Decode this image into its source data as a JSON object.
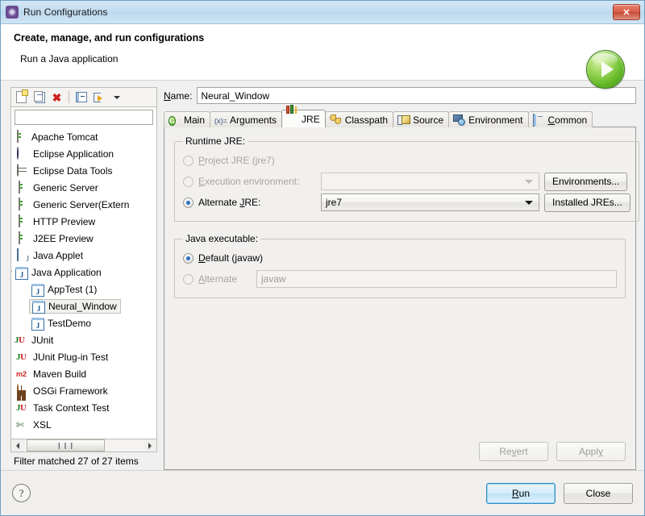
{
  "window": {
    "title": "Run Configurations",
    "title_icon": "gear-icon",
    "close_label": "✕"
  },
  "header": {
    "title": "Create, manage, and run configurations",
    "subtitle": "Run a Java application",
    "badge_icon": "run-play-icon"
  },
  "toolbar": {
    "new_icon": "new-configuration-icon",
    "duplicate_icon": "duplicate-configuration-icon",
    "delete_icon": "delete-configuration-icon",
    "collapse_icon": "collapse-all-icon",
    "filter_icon": "filter-configurations-icon",
    "menu_icon": "chevron-down-icon"
  },
  "filter": {
    "value": "",
    "placeholder": "",
    "status": "Filter matched 27 of 27 items"
  },
  "tree": {
    "items": [
      {
        "label": "Apache Tomcat",
        "icon": "server-icon",
        "indent": 0,
        "twisty": "closed",
        "selected": false
      },
      {
        "label": "Eclipse Application",
        "icon": "eclipse-icon",
        "indent": 0,
        "twisty": "none",
        "selected": false
      },
      {
        "label": "Eclipse Data Tools",
        "icon": "database-icon",
        "indent": 0,
        "twisty": "none",
        "selected": false
      },
      {
        "label": "Generic Server",
        "icon": "server-icon",
        "indent": 0,
        "twisty": "none",
        "selected": false
      },
      {
        "label": "Generic Server(Extern",
        "icon": "server-icon",
        "indent": 0,
        "twisty": "none",
        "selected": false
      },
      {
        "label": "HTTP Preview",
        "icon": "server-icon",
        "indent": 0,
        "twisty": "none",
        "selected": false
      },
      {
        "label": "J2EE Preview",
        "icon": "server-icon",
        "indent": 0,
        "twisty": "none",
        "selected": false
      },
      {
        "label": "Java Applet",
        "icon": "java-applet-icon",
        "indent": 0,
        "twisty": "none",
        "selected": false
      },
      {
        "label": "Java Application",
        "icon": "java-app-icon",
        "indent": 0,
        "twisty": "open",
        "selected": false
      },
      {
        "label": "AppTest (1)",
        "icon": "java-app-icon",
        "indent": 1,
        "twisty": "none",
        "selected": false
      },
      {
        "label": "Neural_Window",
        "icon": "java-app-icon",
        "indent": 1,
        "twisty": "none",
        "selected": true
      },
      {
        "label": "TestDemo",
        "icon": "java-app-icon",
        "indent": 1,
        "twisty": "none",
        "selected": false
      },
      {
        "label": "JUnit",
        "icon": "junit-icon",
        "indent": 0,
        "twisty": "closed",
        "selected": false
      },
      {
        "label": "JUnit Plug-in Test",
        "icon": "junit-plugin-icon",
        "indent": 0,
        "twisty": "none",
        "selected": false
      },
      {
        "label": "Maven Build",
        "icon": "maven-icon",
        "indent": 0,
        "twisty": "none",
        "selected": false
      },
      {
        "label": "OSGi Framework",
        "icon": "osgi-icon",
        "indent": 0,
        "twisty": "none",
        "selected": false
      },
      {
        "label": "Task Context Test",
        "icon": "junit-icon",
        "indent": 0,
        "twisty": "none",
        "selected": false
      },
      {
        "label": "XSL",
        "icon": "xsl-icon",
        "indent": 0,
        "twisty": "none",
        "selected": false
      }
    ]
  },
  "name_field": {
    "label": "Name:",
    "value": "Neural_Window"
  },
  "tabs": [
    {
      "label": "Main",
      "icon": "main-icon",
      "active": false
    },
    {
      "label": "Arguments",
      "icon": "arguments-icon",
      "active": false
    },
    {
      "label": "JRE",
      "icon": "jre-icon",
      "active": true
    },
    {
      "label": "Classpath",
      "icon": "classpath-icon",
      "active": false
    },
    {
      "label": "Source",
      "icon": "source-icon",
      "active": false
    },
    {
      "label": "Environment",
      "icon": "environment-icon",
      "active": false
    },
    {
      "label": "Common",
      "icon": "common-icon",
      "active": false
    }
  ],
  "jre_tab": {
    "runtime_group": {
      "legend": "Runtime JRE:",
      "project_jre_label": "Project JRE (jre7)",
      "project_jre_checked": false,
      "project_jre_disabled": true,
      "exec_env_label": "Execution environment:",
      "exec_env_checked": false,
      "exec_env_disabled": true,
      "exec_env_value": "",
      "environments_button": "Environments...",
      "alternate_jre_label": "Alternate JRE:",
      "alternate_jre_checked": true,
      "alternate_jre_value": "jre7",
      "installed_jres_button": "Installed JREs..."
    },
    "executable_group": {
      "legend": "Java executable:",
      "default_label": "Default (javaw)",
      "default_checked": true,
      "alternate_label": "Alternate",
      "alternate_checked": false,
      "alternate_value": "",
      "alternate_placeholder": "javaw"
    }
  },
  "actions": {
    "revert": "Revert",
    "revert_disabled": true,
    "apply": "Apply",
    "apply_disabled": true
  },
  "footer": {
    "help_icon": "help-icon",
    "help_glyph": "?",
    "run": "Run",
    "close": "Close"
  },
  "colors": {
    "titlebar": "#c4ddf0",
    "accent_default_button": "#2a8ac4",
    "close_button": "#d95f4a",
    "run_badge": "#5fb524",
    "panel_bg": "#f1f0ee"
  }
}
